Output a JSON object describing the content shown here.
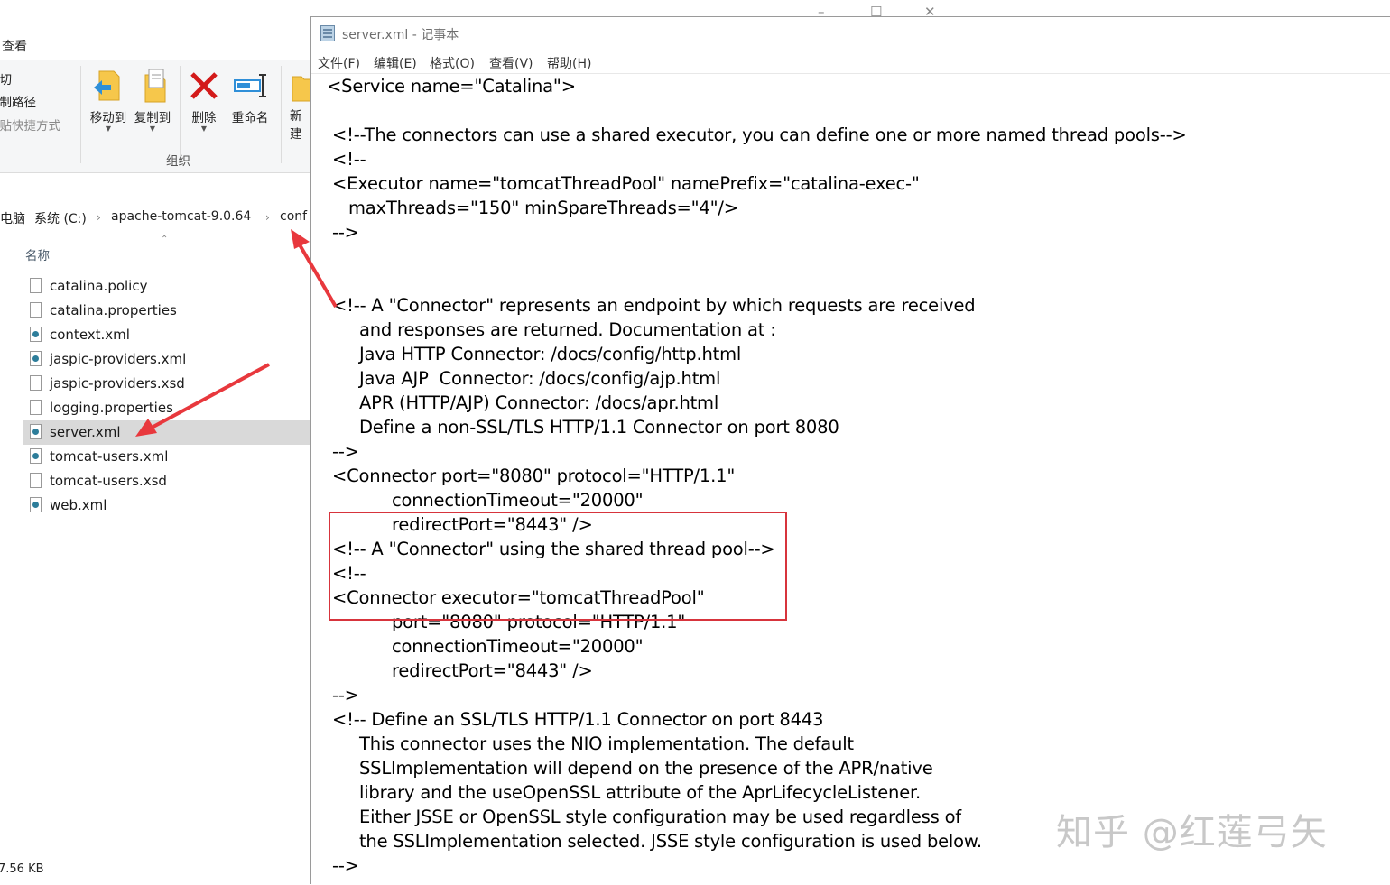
{
  "explorer": {
    "window_controls": [
      "–",
      "☐",
      "✕"
    ],
    "tab_view": "查看",
    "ribbon": {
      "left_items": [
        "剪切",
        "复制路径",
        "粘贴快捷方式"
      ],
      "left_visible": [
        "剪切",
        "复制路径",
        "粘贴快捷方式"
      ],
      "move_to": "移动到",
      "copy_to": "复制到",
      "delete": "删除",
      "rename": "重命名",
      "new_folder": "新建文件夹",
      "group_label": "组织"
    },
    "breadcrumb": {
      "this_pc": "此电脑",
      "drive": "系统 (C:)",
      "folder": "apache-tomcat-9.0.64",
      "current": "conf"
    },
    "column_name": "名称",
    "files": [
      {
        "name": "catalina.policy",
        "type": "doc"
      },
      {
        "name": "catalina.properties",
        "type": "doc"
      },
      {
        "name": "context.xml",
        "type": "xml"
      },
      {
        "name": "jaspic-providers.xml",
        "type": "xml"
      },
      {
        "name": "jaspic-providers.xsd",
        "type": "doc"
      },
      {
        "name": "logging.properties",
        "type": "doc"
      },
      {
        "name": "server.xml",
        "type": "xml",
        "selected": true
      },
      {
        "name": "tomcat-users.xml",
        "type": "xml"
      },
      {
        "name": "tomcat-users.xsd",
        "type": "doc"
      },
      {
        "name": "web.xml",
        "type": "xml"
      }
    ],
    "status": "7.56 KB"
  },
  "notepad": {
    "title": "server.xml - 记事本",
    "menu": [
      "文件(F)",
      "编辑(E)",
      "格式(O)",
      "查看(V)",
      "帮助(H)"
    ],
    "lines": [
      "<Service name=\"Catalina\">",
      "",
      " <!--The connectors can use a shared executor, you can define one or more named thread pools-->",
      " <!--",
      " <Executor name=\"tomcatThreadPool\" namePrefix=\"catalina-exec-\"",
      "    maxThreads=\"150\" minSpareThreads=\"4\"/>",
      " -->",
      "",
      "",
      " <!-- A \"Connector\" represents an endpoint by which requests are received",
      "      and responses are returned. Documentation at :",
      "      Java HTTP Connector: /docs/config/http.html",
      "      Java AJP  Connector: /docs/config/ajp.html",
      "      APR (HTTP/AJP) Connector: /docs/apr.html",
      "      Define a non-SSL/TLS HTTP/1.1 Connector on port 8080",
      " -->",
      " <Connector port=\"8080\" protocol=\"HTTP/1.1\"",
      "            connectionTimeout=\"20000\"",
      "            redirectPort=\"8443\" />",
      " <!-- A \"Connector\" using the shared thread pool-->",
      " <!--",
      " <Connector executor=\"tomcatThreadPool\"",
      "            port=\"8080\" protocol=\"HTTP/1.1\"",
      "            connectionTimeout=\"20000\"",
      "            redirectPort=\"8443\" />",
      " -->",
      " <!-- Define an SSL/TLS HTTP/1.1 Connector on port 8443",
      "      This connector uses the NIO implementation. The default",
      "      SSLImplementation will depend on the presence of the APR/native",
      "      library and the useOpenSSL attribute of the AprLifecycleListener.",
      "      Either JSSE or OpenSSL style configuration may be used regardless of",
      "      the SSLImplementation selected. JSSE style configuration is used below.",
      " -->",
      " <"
    ]
  },
  "annotation": {
    "highlight_color": "#d7343c",
    "arrow_color": "#e8383d"
  },
  "watermark": "知乎 @红莲弓矢"
}
